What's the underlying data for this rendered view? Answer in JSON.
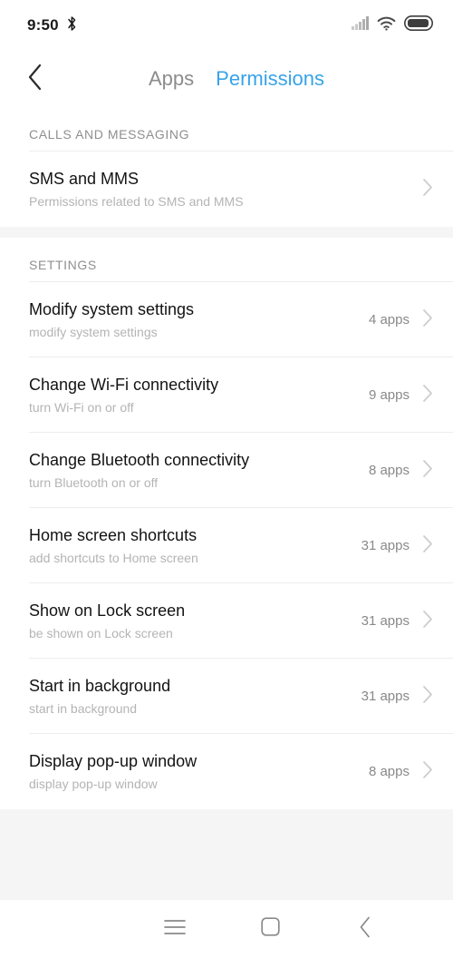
{
  "status_bar": {
    "time": "9:50",
    "bluetooth_icon": "bluetooth-icon",
    "signal_icon": "signal-bars-icon",
    "wifi_icon": "wifi-icon",
    "battery_icon": "battery-icon"
  },
  "header": {
    "back_icon": "back-chevron-icon",
    "tabs": [
      {
        "label": "Apps",
        "active": false
      },
      {
        "label": "Permissions",
        "active": true
      }
    ]
  },
  "colors": {
    "accent": "#37a3e8",
    "tab_inactive": "#8c8c8c",
    "title": "#131313",
    "subtitle": "#b4b4b4",
    "section_header": "#8f8f8f",
    "count": "#898989",
    "divider": "#ededed",
    "page_background": "#f5f5f5",
    "card_background": "#ffffff"
  },
  "sections": [
    {
      "header": "CALLS AND MESSAGING",
      "items": [
        {
          "title": "SMS and MMS",
          "subtitle": "Permissions related to SMS and MMS",
          "count": "",
          "chevron": "chevron-right-icon"
        }
      ]
    },
    {
      "header": "SETTINGS",
      "items": [
        {
          "title": "Modify system settings",
          "subtitle": "modify system settings",
          "count": "4 apps",
          "chevron": "chevron-right-icon"
        },
        {
          "title": "Change Wi-Fi connectivity",
          "subtitle": "turn Wi-Fi on or off",
          "count": "9 apps",
          "chevron": "chevron-right-icon"
        },
        {
          "title": "Change Bluetooth connectivity",
          "subtitle": "turn Bluetooth on or off",
          "count": "8 apps",
          "chevron": "chevron-right-icon"
        },
        {
          "title": "Home screen shortcuts",
          "subtitle": "add shortcuts to Home screen",
          "count": "31 apps",
          "chevron": "chevron-right-icon"
        },
        {
          "title": "Show on Lock screen",
          "subtitle": "be shown on Lock screen",
          "count": "31 apps",
          "chevron": "chevron-right-icon"
        },
        {
          "title": "Start in background",
          "subtitle": "start in background",
          "count": "31 apps",
          "chevron": "chevron-right-icon"
        },
        {
          "title": "Display pop-up window",
          "subtitle": "display pop-up window",
          "count": "8 apps",
          "chevron": "chevron-right-icon"
        }
      ]
    }
  ],
  "nav_bar": {
    "menu_icon": "menu-icon",
    "home_icon": "home-square-icon",
    "back_icon": "back-chevron-icon"
  }
}
